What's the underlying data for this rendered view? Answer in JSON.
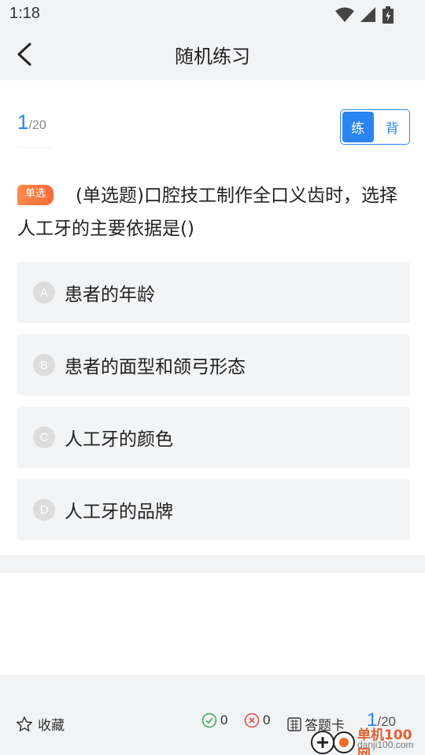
{
  "status_bar": {
    "time": "1:18",
    "icons": [
      "wifi-icon",
      "signal-icon",
      "battery-icon"
    ]
  },
  "app_bar": {
    "title": "随机练习",
    "back_icon": "chevron-left-icon"
  },
  "progress": {
    "current": "1",
    "total": "/20"
  },
  "mode_toggle": {
    "practice_label": "练",
    "recite_label": "背",
    "selected": "练"
  },
  "question": {
    "type_badge": "单选",
    "text": "(单选题)口腔技工制作全口义齿时，选择人工牙的主要依据是()"
  },
  "options": [
    {
      "letter": "A",
      "text": "患者的年龄"
    },
    {
      "letter": "B",
      "text": "患者的面型和颌弓形态"
    },
    {
      "letter": "C",
      "text": "人工牙的颜色"
    },
    {
      "letter": "D",
      "text": "人工牙的品牌"
    }
  ],
  "bottom_bar": {
    "favorite_label": "收藏",
    "correct_count": "0",
    "wrong_count": "0",
    "answer_card_label": "答题卡",
    "progress_current": "1",
    "progress_total": "/20"
  },
  "watermark": {
    "brand": "单机100网",
    "domain": "danji100.com"
  },
  "colors": {
    "accent": "#2c84f0",
    "badge": "#f66a3a",
    "correct": "#3aa657",
    "wrong": "#e04848"
  }
}
